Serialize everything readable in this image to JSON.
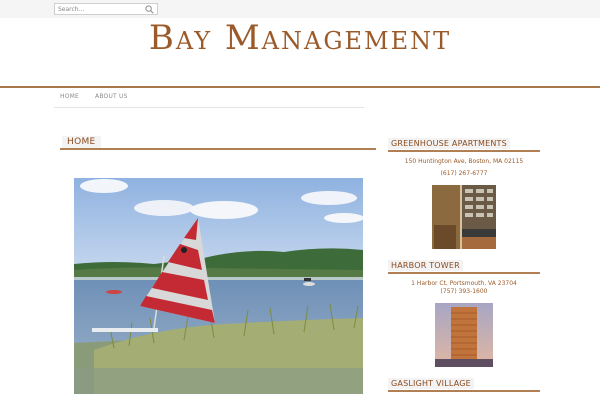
{
  "search": {
    "placeholder": "Search..."
  },
  "site": {
    "title": "Bay Management"
  },
  "nav": {
    "items": [
      {
        "label": "HOME"
      },
      {
        "label": "ABOUT US"
      }
    ]
  },
  "main": {
    "heading": "HOME"
  },
  "sidebar": {
    "properties": [
      {
        "name": "GREENHOUSE APARTMENTS",
        "address": "150 Huntington Ave, Boston, MA 02115",
        "phone": "(617) 267-6777"
      },
      {
        "name": "HARBOR TOWER",
        "address": "1 Harbor Ct, Portsmouth, VA 23704",
        "phone": "(757) 393-1600"
      },
      {
        "name": "GASLIGHT VILLAGE"
      }
    ]
  },
  "colors": {
    "accent": "#9a5a2a",
    "rule": "#b07f53"
  }
}
